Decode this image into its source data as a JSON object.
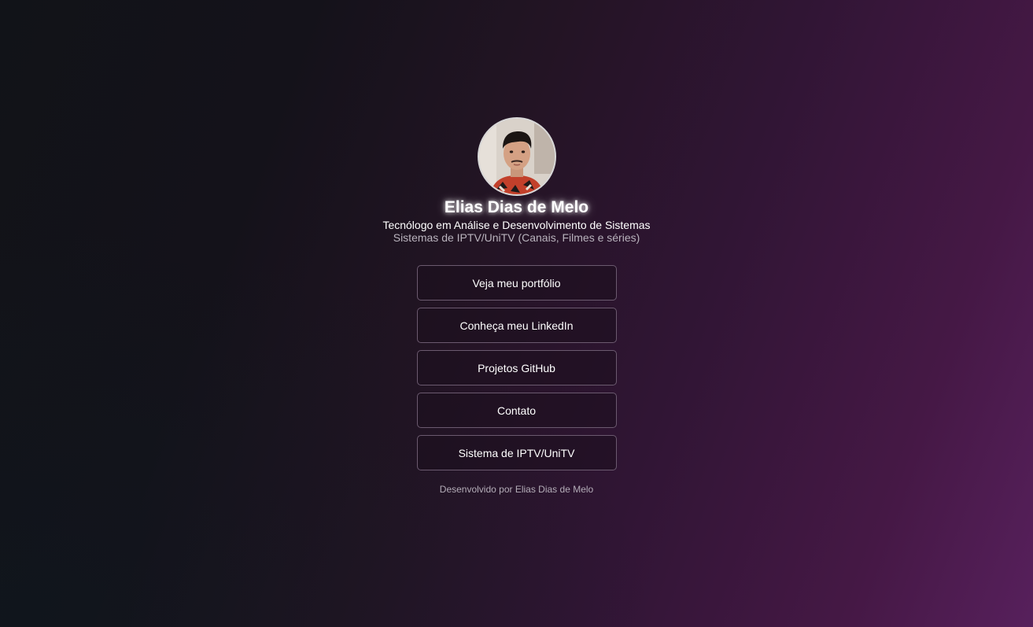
{
  "profile": {
    "name": "Elias Dias de Melo",
    "role": "Tecnólogo em Análise e Desenvolvimento de Sistemas",
    "specialty": "Sistemas de IPTV/UniTV (Canais, Filmes e séries)"
  },
  "links": [
    {
      "label": "Veja meu portfólio"
    },
    {
      "label": "Conheça meu LinkedIn"
    },
    {
      "label": "Projetos GitHub"
    },
    {
      "label": "Contato"
    },
    {
      "label": "Sistema de IPTV/UniTV"
    }
  ],
  "footer": {
    "text": "Desenvolvido por Elias Dias de Melo"
  },
  "colors": {
    "background_left": "#111318",
    "background_right": "#57205c",
    "button_border": "#6b5a6f"
  }
}
